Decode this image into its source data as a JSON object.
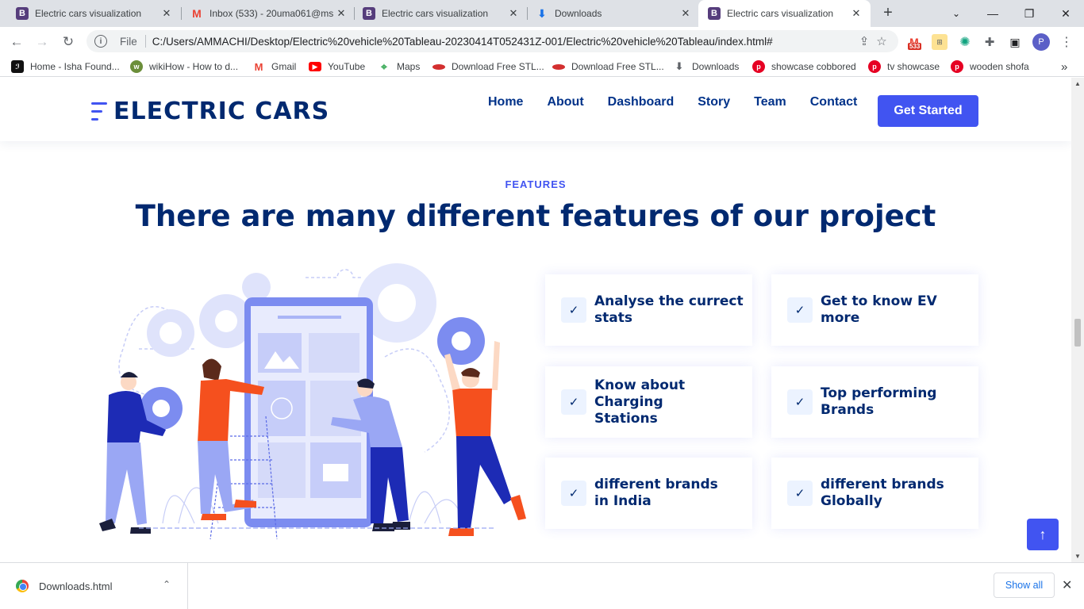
{
  "browser": {
    "tabs": [
      {
        "title": "Electric cars visualization",
        "icon": "bootstrap-icon"
      },
      {
        "title": "Inbox (533) - 20uma061@ms",
        "icon": "gmail-icon"
      },
      {
        "title": "Electric cars visualization",
        "icon": "bootstrap-icon"
      },
      {
        "title": "Downloads",
        "icon": "download-icon"
      },
      {
        "title": "Electric cars visualization",
        "icon": "bootstrap-icon",
        "active": true
      }
    ],
    "new_tab": "+",
    "close_glyph": "✕",
    "address": {
      "scheme": "File",
      "url": "C:/Users/AMMACHI/Desktop/Electric%20vehicle%20Tableau-20230414T052431Z-001/Electric%20vehicle%20Tableau/index.html#"
    },
    "gmail_badge": "533",
    "profile_initial": "P",
    "bookmarks": [
      {
        "label": "Home - Isha Found...",
        "icon": "isha-icon"
      },
      {
        "label": "wikiHow - How to d...",
        "icon": "wikihow-icon"
      },
      {
        "label": "Gmail",
        "icon": "gmail-icon"
      },
      {
        "label": "YouTube",
        "icon": "youtube-icon"
      },
      {
        "label": "Maps",
        "icon": "maps-icon"
      },
      {
        "label": "Download Free STL...",
        "icon": "stl-icon"
      },
      {
        "label": "Download Free STL...",
        "icon": "stl-icon"
      },
      {
        "label": "Downloads",
        "icon": "download-icon"
      },
      {
        "label": "showcase cobbored",
        "icon": "pinterest-icon"
      },
      {
        "label": "tv showcase",
        "icon": "pinterest-icon"
      },
      {
        "label": "wooden shofa",
        "icon": "pinterest-icon"
      }
    ],
    "bookmarks_more": "»"
  },
  "site": {
    "logo_text": "ELECTRIC CARS",
    "nav": [
      "Home",
      "About",
      "Dashboard",
      "Story",
      "Team",
      "Contact"
    ],
    "cta": "Get Started",
    "eyebrow": "FEATURES",
    "heading": "There are many different features of our project",
    "features": [
      "Analyse the currect stats",
      "Get to know EV more",
      "Know about Charging Stations",
      "Top performing Brands",
      "different brands in India",
      "different brands Globally"
    ],
    "check_glyph": "✓",
    "back_top_glyph": "↑"
  },
  "downloads": {
    "file": "Downloads.html",
    "show_all": "Show all",
    "caret": "⌃",
    "close": "✕"
  },
  "colors": {
    "accent": "#4154f1",
    "heading": "#012970",
    "orange": "#f5501e"
  }
}
